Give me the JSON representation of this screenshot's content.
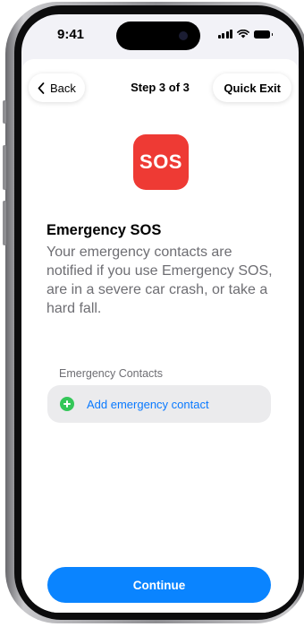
{
  "status_bar": {
    "time": "9:41"
  },
  "navbar": {
    "back_label": "Back",
    "title": "Step 3 of 3",
    "quick_exit_label": "Quick Exit"
  },
  "sos_icon": {
    "label": "SOS",
    "color": "#ee3a34"
  },
  "content": {
    "heading": "Emergency SOS",
    "description": "Your emergency contacts are notified if you use Emergency SOS, are in a severe car crash, or take a hard fall."
  },
  "emergency_contacts": {
    "section_label": "Emergency Contacts",
    "add_label": "Add emergency contact",
    "add_icon_color": "#34c759",
    "link_color": "#0a7aff"
  },
  "footer": {
    "continue_label": "Continue",
    "accent": "#0a84ff"
  }
}
